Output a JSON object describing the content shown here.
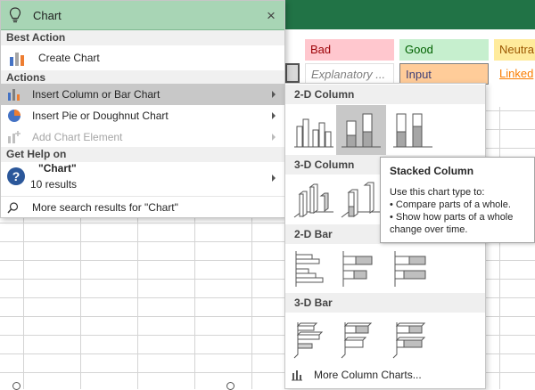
{
  "search": {
    "query": "Chart",
    "close_label": "×"
  },
  "sections": {
    "best_action": "Best Action",
    "actions": "Actions",
    "get_help": "Get Help on"
  },
  "items": {
    "create_chart": "Create Chart",
    "insert_column": "Insert Column or Bar Chart",
    "insert_pie": "Insert Pie or Doughnut Chart",
    "add_element": "Add Chart Element",
    "help_title": "\"Chart\"",
    "help_results": "10 results",
    "more_search": "More search results for \"Chart\""
  },
  "styles": {
    "bad": "Bad",
    "good": "Good",
    "neutral": "Neutra",
    "explanatory": "Explanatory ...",
    "input": "Input",
    "linked": "Linked"
  },
  "gallery": {
    "sec_2d_col": "2-D Column",
    "sec_3d_col": "3-D Column",
    "sec_2d_bar": "2-D Bar",
    "sec_3d_bar": "3-D Bar",
    "more": "More Column Charts..."
  },
  "tooltip": {
    "title": "Stacked Column",
    "line1": "Use this chart type to:",
    "line2": "• Compare parts of a whole.",
    "line3": "• Show how parts of a whole",
    "line4": "change over time."
  },
  "colors": {
    "ribbon": "#217346",
    "panel_header": "#a8d5b5",
    "bad_bg": "#ffc7ce",
    "bad_fg": "#9c0006",
    "good_bg": "#c6efce",
    "good_fg": "#006100",
    "neutral_bg": "#ffeb9c",
    "neutral_fg": "#9c5700",
    "input_bg": "#ffcc99",
    "input_fg": "#3f3f76",
    "linked_fg": "#fa7d00"
  }
}
